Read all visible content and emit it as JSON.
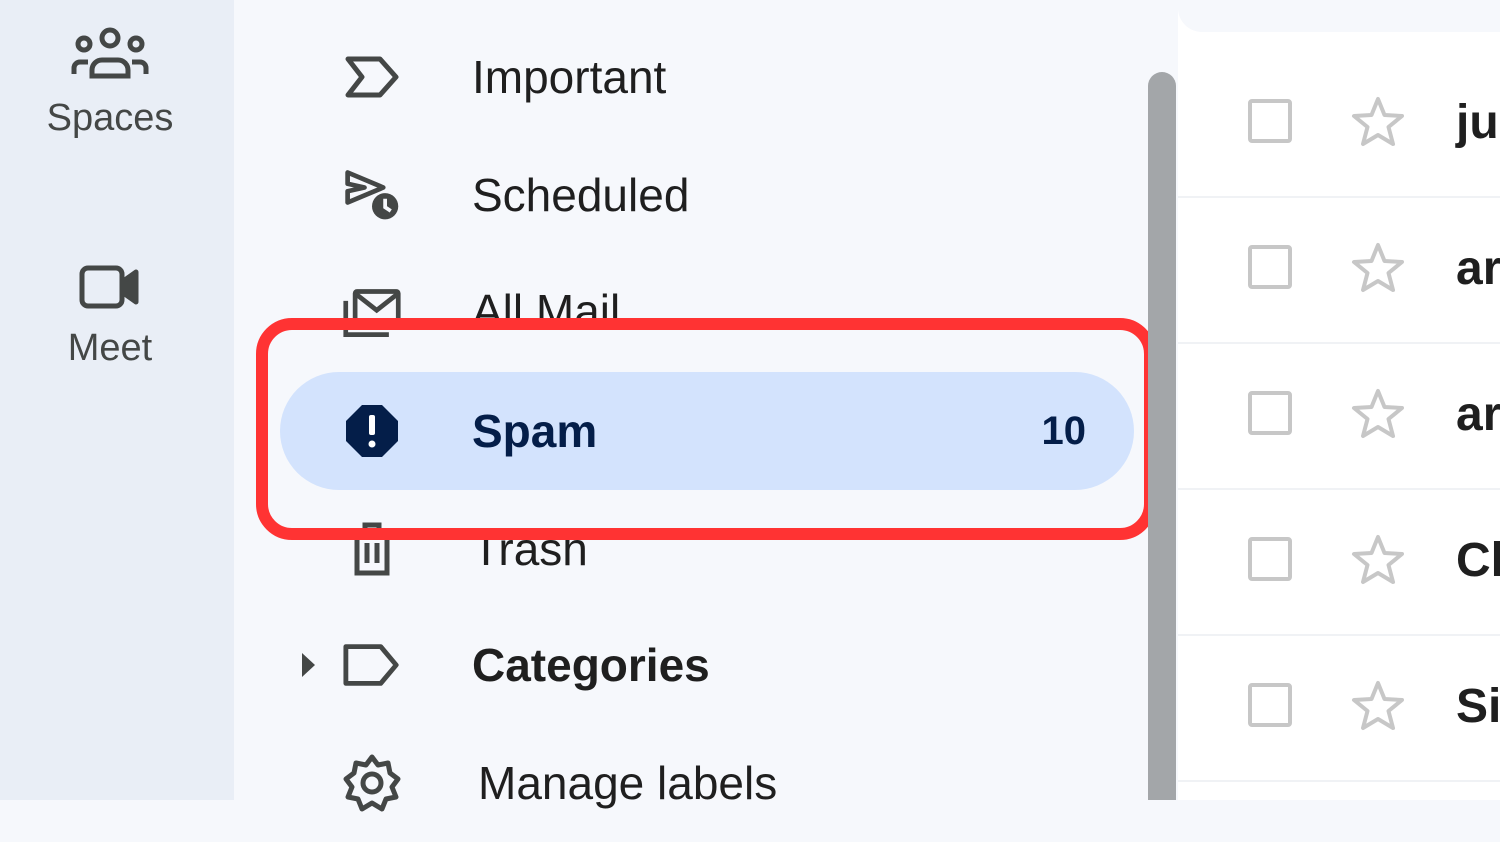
{
  "rail": {
    "items": [
      {
        "label": "Spaces",
        "icon": "people-group-icon"
      },
      {
        "label": "Meet",
        "icon": "video-camera-icon"
      }
    ]
  },
  "nav": {
    "items": [
      {
        "label": "Important",
        "icon": "important-label-icon"
      },
      {
        "label": "Scheduled",
        "icon": "scheduled-send-icon"
      },
      {
        "label": "All Mail",
        "icon": "all-mail-icon"
      },
      {
        "label": "Spam",
        "icon": "spam-report-icon",
        "count": "10",
        "active": true
      },
      {
        "label": "Trash",
        "icon": "trash-icon"
      },
      {
        "label": "Categories",
        "icon": "label-icon",
        "expandable": true
      },
      {
        "label": "Manage labels",
        "icon": "gear-icon"
      }
    ]
  },
  "mail_list": {
    "rows": [
      {
        "sender": "ju"
      },
      {
        "sender": "ar"
      },
      {
        "sender": "ar"
      },
      {
        "sender": "Cl"
      },
      {
        "sender": "Si"
      }
    ]
  },
  "colors": {
    "highlight": "#ff3333",
    "active_bg": "#d3e3fd",
    "active_text": "#041e49",
    "rail_bg": "#e9eef6",
    "nav_bg": "#f6f8fc"
  }
}
